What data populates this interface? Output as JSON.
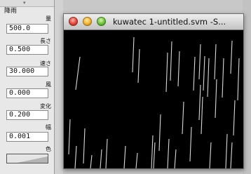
{
  "panel": {
    "section_title": "降雨",
    "properties": [
      {
        "label": "量",
        "value": "500.0"
      },
      {
        "label": "長さ",
        "value": "0.500"
      },
      {
        "label": "速さ",
        "value": "30.000"
      },
      {
        "label": "風",
        "value": "0.000"
      },
      {
        "label": "変化",
        "value": "0.200"
      },
      {
        "label": "幅",
        "value": "0.001"
      }
    ],
    "color_label": "色"
  },
  "window": {
    "title": "kuwatec 1-untitled.svm -S..."
  },
  "colors": {
    "canvas_background": "#000000",
    "rain_stroke": "#d8d8d8"
  }
}
